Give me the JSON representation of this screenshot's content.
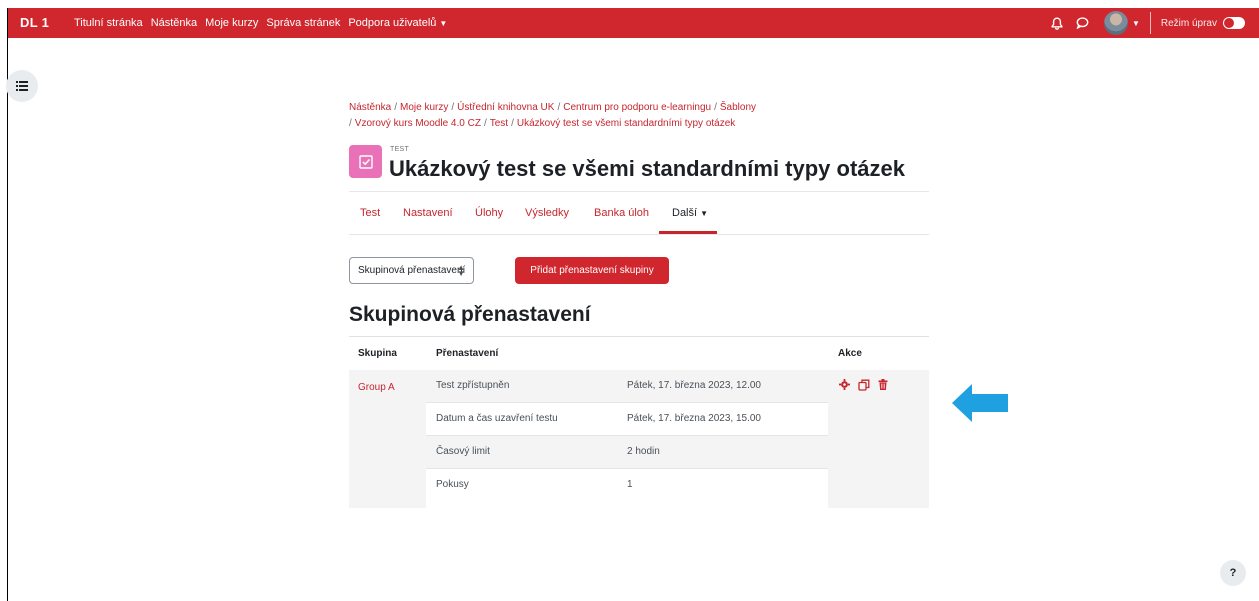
{
  "navbar": {
    "brand": "DL 1",
    "links": [
      "Titulní stránka",
      "Nástěnka",
      "Moje kurzy",
      "Správa stránek",
      "Podpora uživatelů"
    ],
    "edit_mode_label": "Režim úprav",
    "color": "#d0262d"
  },
  "breadcrumb": {
    "items": [
      "Nástěnka",
      "Moje kurzy",
      "Ústřední knihovna UK",
      "Centrum pro podporu e-learningu",
      "Šablony",
      "Vzorový kurs Moodle 4.0 CZ",
      "Test",
      "Ukázkový test se všemi standardními typy otázek"
    ]
  },
  "page": {
    "pre_title": "TEST",
    "title": "Ukázkový test se všemi standardními typy otázek",
    "icon": "quiz-icon"
  },
  "tabs": {
    "items": [
      "Test",
      "Nastavení",
      "Úlohy",
      "Výsledky",
      "Banka úloh",
      "Další"
    ],
    "active": "Další"
  },
  "controls": {
    "select_value": "Skupinová přenastavení",
    "add_button": "Přidat přenastavení skupiny"
  },
  "section": {
    "title": "Skupinová přenastavení"
  },
  "table": {
    "headers": {
      "group": "Skupina",
      "override": "Přenastavení",
      "actions": "Akce"
    },
    "group": "Group A",
    "rows": [
      {
        "setting": "Test zpřístupněn",
        "value": "Pátek, 17. března 2023, 12.00"
      },
      {
        "setting": "Datum a čas uzavření testu",
        "value": "Pátek, 17. března 2023, 15.00"
      },
      {
        "setting": "Časový limit",
        "value": "2 hodin"
      },
      {
        "setting": "Pokusy",
        "value": "1"
      }
    ],
    "action_icons": [
      "settings-icon",
      "copy-icon",
      "trash-icon"
    ]
  },
  "help": {
    "label": "?"
  }
}
